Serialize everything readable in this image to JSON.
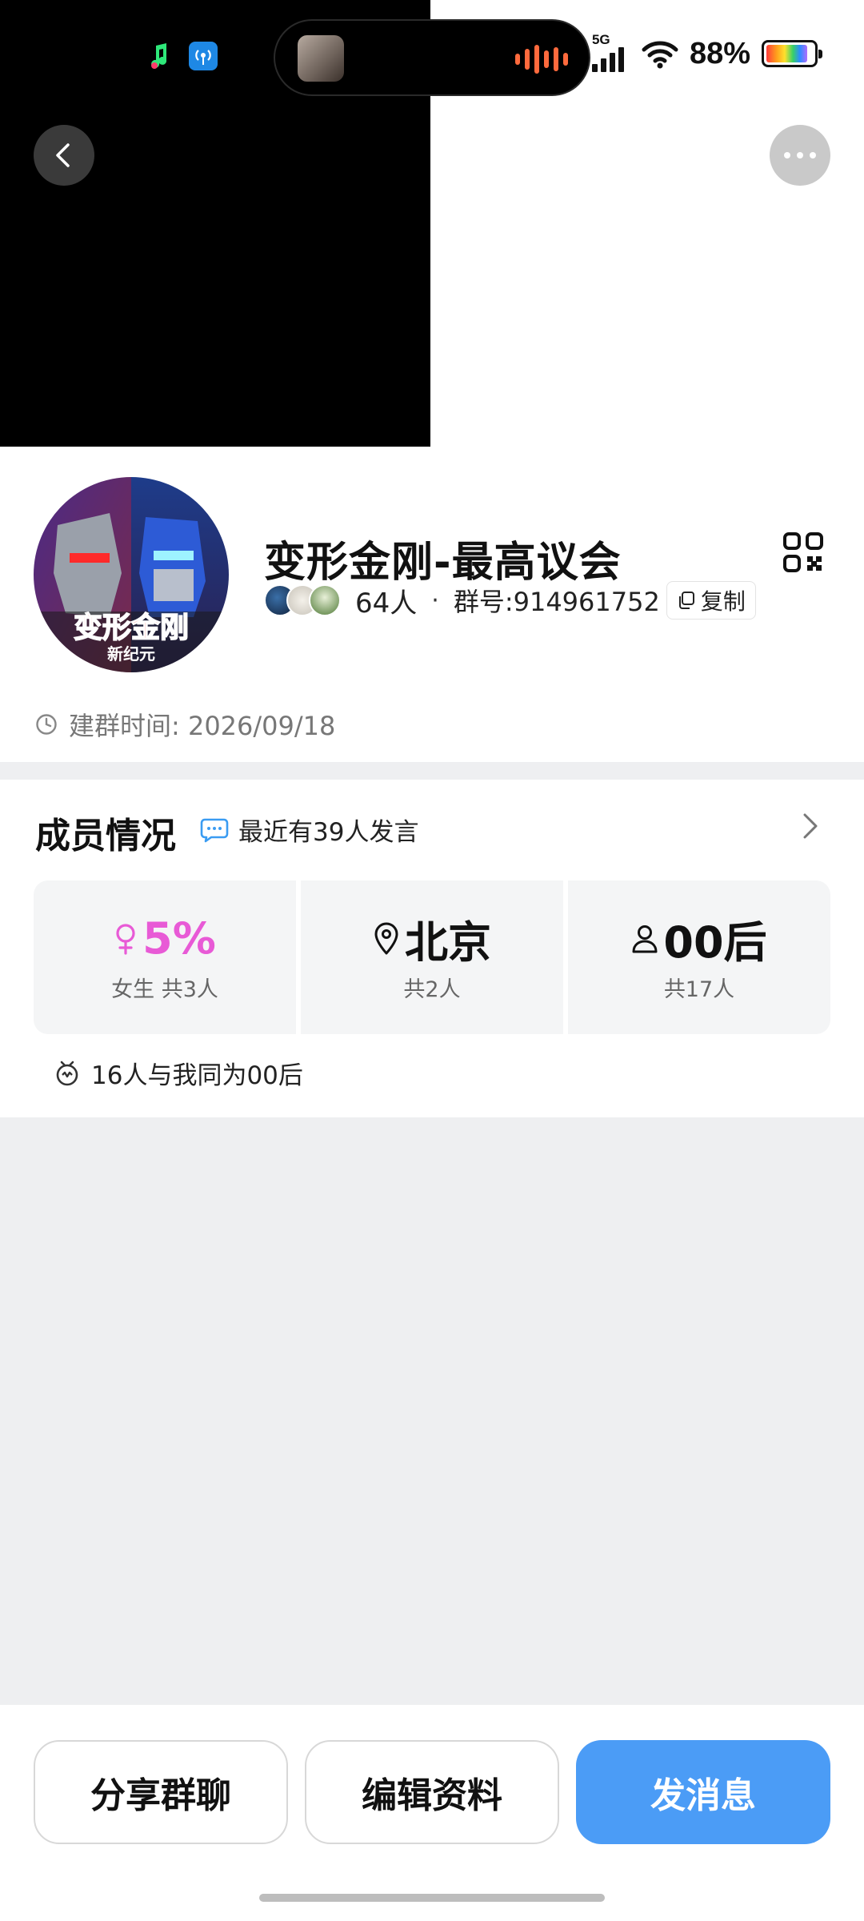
{
  "status_bar": {
    "network": "5G",
    "battery_percent": "88%",
    "battery_level": 0.88
  },
  "nav": {
    "back_icon": "chevron-left-icon",
    "more_icon": "more-dots-icon"
  },
  "group": {
    "avatar_caption": "变形金刚",
    "avatar_subcaption": "新纪元",
    "name": "变形金刚-最高议会",
    "member_count": "64人",
    "separator": "·",
    "group_id": "群号:914961752",
    "copy_label": "复制",
    "created": "建群时间: 2026/09/18"
  },
  "members": {
    "title": "成员情况",
    "recent_speakers": "最近有39人发言",
    "stats": [
      {
        "icon": "female-icon",
        "value": "5%",
        "sub": "女生 共3人",
        "color": "#e85ad6"
      },
      {
        "icon": "location-pin-icon",
        "value": "北京",
        "sub": "共2人",
        "color": "#111111"
      },
      {
        "icon": "person-icon",
        "value": "00后",
        "sub": "共17人",
        "color": "#111111"
      }
    ],
    "same_age": "16人与我同为00后"
  },
  "actions": {
    "share": "分享群聊",
    "edit": "编辑资料",
    "message": "发消息"
  },
  "colors": {
    "primary": "#4b9cf6",
    "female_accent": "#e85ad6",
    "background_gray": "#eeeff1"
  }
}
